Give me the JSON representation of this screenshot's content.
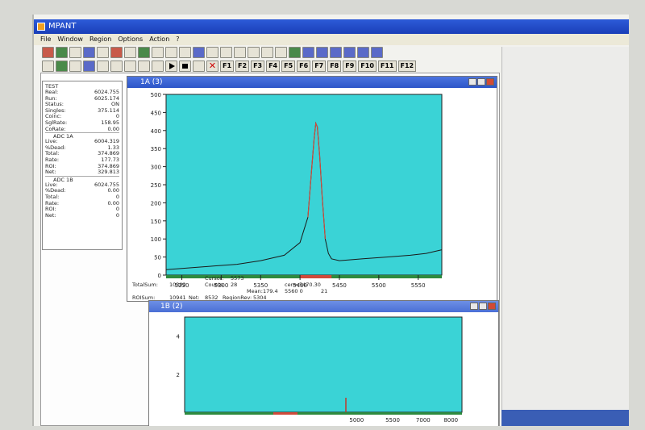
{
  "window": {
    "title": "MPANT"
  },
  "menu": [
    "File",
    "Window",
    "Region",
    "Options",
    "Action",
    "?"
  ],
  "fkeys": [
    "F1",
    "F2",
    "F3",
    "F4",
    "F5",
    "F6",
    "F7",
    "F8",
    "F9",
    "F10",
    "F11",
    "F12"
  ],
  "stats": {
    "title": "TEST",
    "rows": [
      {
        "label": "Real:",
        "value": "6024.755"
      },
      {
        "label": "Run:",
        "value": "6025.174"
      },
      {
        "label": "Status:",
        "value": "ON"
      },
      {
        "label": "Singles:",
        "value": "375.114"
      },
      {
        "label": "Coinc:",
        "value": "0"
      },
      {
        "label": "SglRate:",
        "value": "158.95"
      },
      {
        "label": "CoRate:",
        "value": "0.00"
      }
    ],
    "adc1": {
      "title": "ADC 1A",
      "rows": [
        {
          "label": "Live:",
          "value": "6004.319"
        },
        {
          "label": "%Dead:",
          "value": "1.33"
        },
        {
          "label": "Total:",
          "value": "374.869"
        },
        {
          "label": "Rate:",
          "value": "177.73"
        },
        {
          "label": "ROI:",
          "value": "374.869"
        },
        {
          "label": "Net:",
          "value": "329.813"
        }
      ]
    },
    "adc2": {
      "title": "ADC 1B",
      "rows": [
        {
          "label": "Live:",
          "value": "6024.755"
        },
        {
          "label": "%Dead:",
          "value": "0.00"
        },
        {
          "label": "Total:",
          "value": "0"
        },
        {
          "label": "Rate:",
          "value": "0.00"
        },
        {
          "label": "ROI:",
          "value": "0"
        },
        {
          "label": "Net:",
          "value": "0"
        }
      ]
    }
  },
  "spectrum_window": {
    "title": "1A (3)"
  },
  "spectrum2_window": {
    "title": "1B (2)"
  },
  "readout": {
    "totalsum_label": "TotalSum:",
    "totalsum_value": "10302",
    "roisum_label": "ROISum:",
    "roisum_value": "10941",
    "net_label": "Net:",
    "net_value": "8532",
    "roi_label": "ROI 0001",
    "roi_range": "5490  5510",
    "region_label": "RegionRev:",
    "region_value": "5304",
    "cursor_label": "Cursor:",
    "cursor_value": "5573",
    "counts_label": "Counts:",
    "counts_value": "28",
    "mean_label": "Mean:",
    "mean_value": "179.4",
    "cen_label": "cen=",
    "cen_value": "5470.30",
    "extra_value": "5560  0",
    "extra2_value": "21"
  },
  "chart_data": [
    {
      "type": "line",
      "title": "1A (3)",
      "xlabel": "",
      "ylabel": "",
      "xlim": [
        5230,
        5580
      ],
      "ylim": [
        0,
        500
      ],
      "x_ticks": [
        5250,
        5300,
        5350,
        5400,
        5450,
        5500,
        5550
      ],
      "x_tick_labels": [
        "5250",
        "5300",
        "5350",
        "5400",
        "5450",
        "5500",
        "5550"
      ],
      "y_ticks": [
        0,
        50,
        100,
        150,
        200,
        250,
        300,
        350,
        400,
        450,
        500
      ],
      "grid": false,
      "series": [
        {
          "x": [
            5230,
            5260,
            5290,
            5320,
            5350,
            5380,
            5400,
            5410,
            5415,
            5418,
            5420,
            5422,
            5425,
            5428,
            5432,
            5436,
            5440,
            5450,
            5480,
            5510,
            5540,
            5560,
            5580
          ],
          "values": [
            15,
            20,
            25,
            30,
            40,
            55,
            90,
            160,
            300,
            380,
            420,
            410,
            330,
            220,
            100,
            60,
            45,
            40,
            45,
            50,
            55,
            60,
            70
          ]
        }
      ],
      "colors": {
        "background": "#3ad3d6",
        "trace": "#1a1a1a",
        "roi": "#d04a3a",
        "axis_band": "#2e8a3e"
      }
    },
    {
      "type": "line",
      "title": "1B (2)",
      "xlim": [
        5230,
        5580
      ],
      "ylim": [
        0,
        5
      ],
      "x_ticks": [
        5500,
        5700,
        6000
      ],
      "x_tick_labels": [
        "5000",
        "5500",
        "7000",
        "8000"
      ],
      "y_ticks": [
        2,
        4
      ],
      "series": []
    }
  ]
}
